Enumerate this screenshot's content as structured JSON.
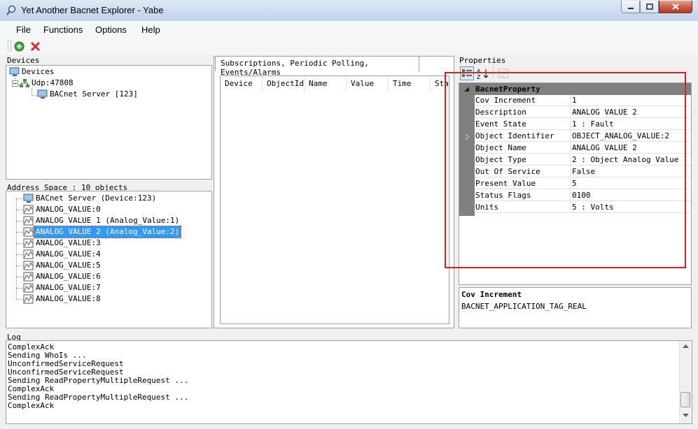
{
  "window": {
    "title": "Yet Another Bacnet Explorer - Yabe"
  },
  "menu": {
    "file": "File",
    "functions": "Functions",
    "options": "Options",
    "help": "Help"
  },
  "devices": {
    "label": "Devices",
    "root": "Devices",
    "transport": "Udp:47808",
    "server": "BACnet Server [123]"
  },
  "address_space": {
    "label": "Address Space : 10 objects",
    "items": [
      "BACnet Server (Device:123)",
      "ANALOG_VALUE:0",
      "ANALOG VALUE 1 (Analog_Value:1)",
      "ANALOG VALUE 2 (Analog_Value:2)",
      "ANALOG_VALUE:3",
      "ANALOG_VALUE:4",
      "ANALOG_VALUE:5",
      "ANALOG_VALUE:6",
      "ANALOG_VALUE:7",
      "ANALOG_VALUE:8"
    ]
  },
  "subscriptions": {
    "tab_label": "Subscriptions, Periodic Polling, Events/Alarms",
    "columns": [
      "Device",
      "ObjectId",
      "Name",
      "Value",
      "Time",
      "Sta"
    ]
  },
  "properties": {
    "label": "Properties",
    "category": "BacnetProperty",
    "rows": [
      {
        "name": "Cov Increment",
        "value": "1"
      },
      {
        "name": "Description",
        "value": "ANALOG VALUE 2"
      },
      {
        "name": "Event State",
        "value": "1 : Fault"
      },
      {
        "name": "Object Identifier",
        "value": "OBJECT_ANALOG_VALUE:2"
      },
      {
        "name": "Object Name",
        "value": "ANALOG VALUE 2"
      },
      {
        "name": "Object Type",
        "value": "2 : Object Analog Value"
      },
      {
        "name": "Out Of Service",
        "value": "False"
      },
      {
        "name": "Present Value",
        "value": "5"
      },
      {
        "name": "Status Flags",
        "value": "0100"
      },
      {
        "name": "Units",
        "value": "5 : Volts"
      }
    ],
    "help_title": "Cov Increment",
    "help_text": "BACNET_APPLICATION_TAG_REAL"
  },
  "log": {
    "label": "Log",
    "lines": [
      "ComplexAck",
      "Sending WhoIs ...",
      "UnconfirmedServiceRequest",
      "UnconfirmedServiceRequest",
      "Sending ReadPropertyMultipleRequest ...",
      "ComplexAck",
      "Sending ReadPropertyMultipleRequest ...",
      "ComplexAck"
    ]
  },
  "colors": {
    "selection": "#3399ff",
    "highlight_box": "#e02020",
    "grid_gutter": "#808080"
  }
}
